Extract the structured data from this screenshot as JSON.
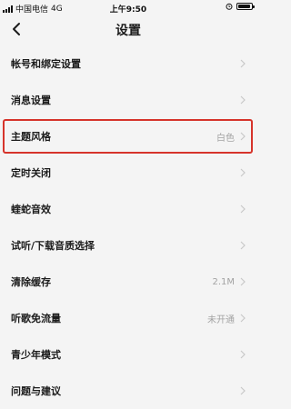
{
  "status_bar": {
    "carrier": "中国电信",
    "network": "4G",
    "time": "上午9:50"
  },
  "header": {
    "title": "设置"
  },
  "settings": [
    {
      "label": "帐号和绑定设置",
      "value": ""
    },
    {
      "label": "消息设置",
      "value": ""
    },
    {
      "label": "主题风格",
      "value": "白色",
      "highlighted": true
    },
    {
      "label": "定时关闭",
      "value": ""
    },
    {
      "label": "蝰蛇音效",
      "value": ""
    },
    {
      "label": "试听/下载音质选择",
      "value": ""
    },
    {
      "label": "清除缓存",
      "value": "2.1M"
    },
    {
      "label": "听歌免流量",
      "value": "未开通"
    },
    {
      "label": "青少年模式",
      "value": ""
    },
    {
      "label": "问题与建议",
      "value": ""
    }
  ],
  "colors": {
    "background": "#f4f4f4",
    "highlight_border": "#d6342b",
    "secondary_text": "#a3a3a3",
    "chevron": "#c8c8c8"
  },
  "icons": {
    "back": "chevron-left-icon",
    "row_arrow": "chevron-right-icon",
    "alarm": "alarm-clock-icon",
    "battery": "battery-icon",
    "signal": "signal-bars-icon"
  }
}
